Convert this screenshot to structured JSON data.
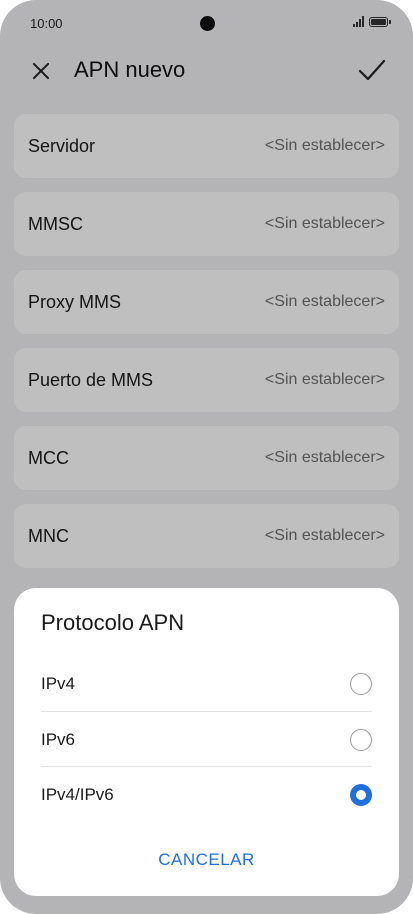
{
  "status": {
    "time": "10:00"
  },
  "header": {
    "title": "APN nuevo",
    "close_icon": "close-icon",
    "confirm_icon": "check-icon"
  },
  "settings": [
    {
      "label": "Servidor",
      "value": "<Sin establecer>"
    },
    {
      "label": "MMSC",
      "value": "<Sin establecer>"
    },
    {
      "label": "Proxy MMS",
      "value": "<Sin establecer>"
    },
    {
      "label": "Puerto de MMS",
      "value": "<Sin establecer>"
    },
    {
      "label": "MCC",
      "value": "<Sin establecer>"
    },
    {
      "label": "MNC",
      "value": "<Sin establecer>"
    }
  ],
  "dialog": {
    "title": "Protocolo APN",
    "options": [
      {
        "label": "IPv4",
        "selected": false
      },
      {
        "label": "IPv6",
        "selected": false
      },
      {
        "label": "IPv4/IPv6",
        "selected": true
      }
    ],
    "cancel_label": "CANCELAR"
  },
  "colors": {
    "accent": "#1f6fe0",
    "background": "#f1f1f3",
    "card": "#ffffff"
  }
}
